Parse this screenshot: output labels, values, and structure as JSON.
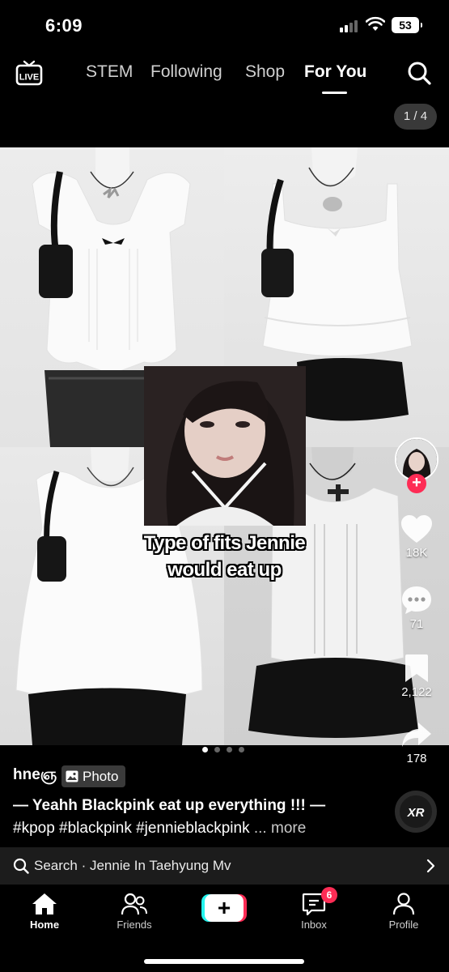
{
  "status_bar": {
    "time": "6:09",
    "battery": "53"
  },
  "top_nav": {
    "live_label": "LIVE",
    "tabs": [
      {
        "label": "STEM"
      },
      {
        "label": "Following"
      },
      {
        "label": "Shop"
      },
      {
        "label": "For You",
        "active": true
      }
    ]
  },
  "post": {
    "page_counter": "1 / 4",
    "overlay_line1": "Type of fits Jennie",
    "overlay_line2": "would eat up",
    "author": "hneஞ",
    "type_badge": "Photo",
    "caption": "— Yeahh Blackpink eat up everything !!! —",
    "hashtags": "#kpop #blackpink #jennieblackpink",
    "more_label": "... more",
    "sound_disc_text": "XR",
    "slide_count": 4,
    "active_slide": 1
  },
  "actions": {
    "likes": "18K",
    "comments": "71",
    "bookmarks": "2,122",
    "shares": "178"
  },
  "search_bar": {
    "text": "Search · Jennie In Taehyung Mv"
  },
  "bottom_nav": {
    "items": [
      {
        "label": "Home",
        "active": true
      },
      {
        "label": "Friends"
      },
      {
        "label": ""
      },
      {
        "label": "Inbox",
        "badge": "6"
      },
      {
        "label": "Profile"
      }
    ]
  },
  "colors": {
    "accent": "#fe2c55",
    "cyan": "#25f4ee",
    "background": "#000000"
  }
}
